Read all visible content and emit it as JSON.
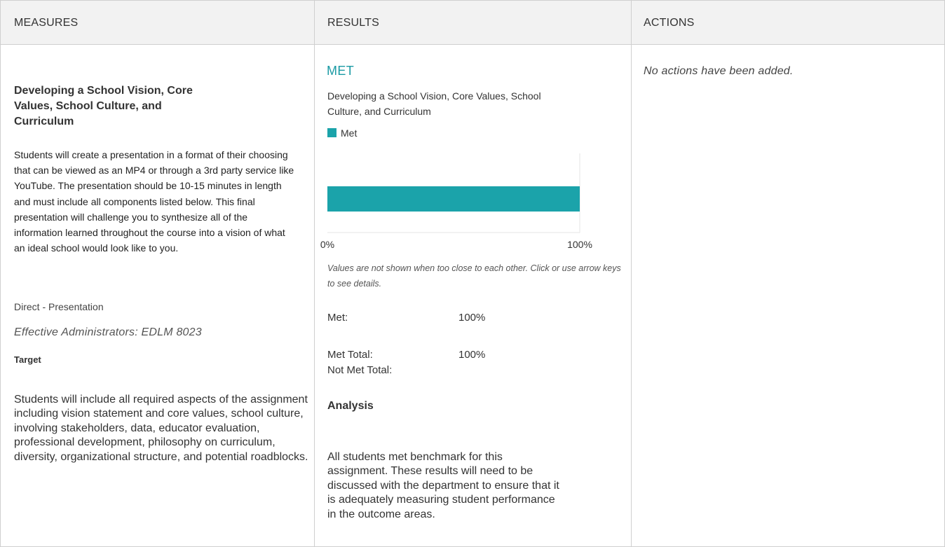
{
  "headers": {
    "measures": "MEASURES",
    "results": "RESULTS",
    "actions": "ACTIONS"
  },
  "measure": {
    "title": "Developing a School Vision, Core Values, School Culture, and Curriculum",
    "description": "Students will create a presentation in a format of their choosing that can be viewed as an MP4 or through a 3rd party service like YouTube. The presentation should be 10-15 minutes in length and must include all components listed below. This final presentation will challenge you to synthesize all of the information learned throughout the course into a vision of what an ideal school would look like to you.",
    "method": "Direct - Presentation",
    "course": "Effective Administrators: EDLM 8023",
    "target_label": "Target",
    "target": "Students will include all required aspects of the assignment including vision statement and core values, school culture, involving stakeholders, data, educator evaluation, professional development, philosophy on curriculum, diversity, organizational structure, and potential roadblocks."
  },
  "results": {
    "status": "MET",
    "chart_title": "Developing a School Vision, Core Values, School Culture, and Curriculum",
    "chart_note": "Values are not shown when too close to each other. Click or use arrow keys to see details.",
    "met_label": "Met:",
    "met_value": "100%",
    "met_total_label": "Met Total:",
    "met_total_value": "100%",
    "not_met_total_label": "Not Met Total:",
    "analysis_label": "Analysis",
    "analysis": "All students met benchmark for this assignment.  These results will need to be discussed with the department to ensure that it is adequately measuring student performance in the outcome areas."
  },
  "actions": {
    "empty": "No actions have been added."
  },
  "colors": {
    "accent": "#1a9aa4",
    "bar": "#1ba3aa",
    "header_bg": "#f2f2f2",
    "border": "#cfcfcf"
  },
  "chart_data": {
    "type": "bar",
    "orientation": "horizontal",
    "stacked": true,
    "categories": [
      "Met"
    ],
    "series": [
      {
        "name": "Met",
        "values": [
          100
        ]
      }
    ],
    "xlim": [
      0,
      100
    ],
    "xtick_labels": [
      "0%",
      "100%"
    ],
    "legend_position": "top-left",
    "grid": false
  }
}
